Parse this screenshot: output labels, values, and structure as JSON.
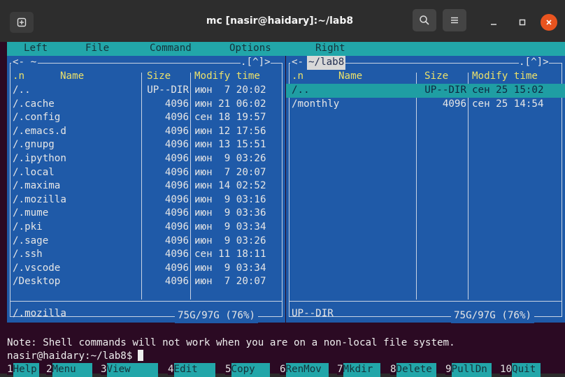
{
  "window": {
    "title": "mc [nasir@haidary]:~/lab8"
  },
  "menubar": {
    "items": [
      "Left",
      "File",
      "Command",
      "Options",
      "Right"
    ]
  },
  "left_panel": {
    "path": "~",
    "corner": ".[^]>",
    "columns": [
      ".n",
      "Name",
      "Size",
      "Modify time"
    ],
    "rows": [
      {
        "name": "/..",
        "size": "UP--DIR",
        "date": "июн  7 20:02"
      },
      {
        "name": "/.cache",
        "size": "4096",
        "date": "июн 21 06:02"
      },
      {
        "name": "/.config",
        "size": "4096",
        "date": "сен 18 19:57"
      },
      {
        "name": "/.emacs.d",
        "size": "4096",
        "date": "июн 12 17:56"
      },
      {
        "name": "/.gnupg",
        "size": "4096",
        "date": "июн 13 15:51"
      },
      {
        "name": "/.ipython",
        "size": "4096",
        "date": "июн  9 03:26"
      },
      {
        "name": "/.local",
        "size": "4096",
        "date": "июн  7 20:07"
      },
      {
        "name": "/.maxima",
        "size": "4096",
        "date": "июн 14 02:52"
      },
      {
        "name": "/.mozilla",
        "size": "4096",
        "date": "июн  9 03:16"
      },
      {
        "name": "/.mume",
        "size": "4096",
        "date": "июн  9 03:36"
      },
      {
        "name": "/.pki",
        "size": "4096",
        "date": "июн  9 03:34"
      },
      {
        "name": "/.sage",
        "size": "4096",
        "date": "июн  9 03:26"
      },
      {
        "name": "/.ssh",
        "size": "4096",
        "date": "сен 11 18:11"
      },
      {
        "name": "/.vscode",
        "size": "4096",
        "date": "июн  9 03:34"
      },
      {
        "name": "/Desktop",
        "size": "4096",
        "date": "июн  7 20:07"
      }
    ],
    "status": "/.mozilla",
    "usage": "75G/97G (76%)"
  },
  "right_panel": {
    "path": "~/lab8",
    "corner": ".[^]>",
    "columns": [
      ".n",
      "Name",
      "Size",
      "Modify time"
    ],
    "rows": [
      {
        "name": "/..",
        "size": "UP--DIR",
        "date": "сен 25 15:02"
      },
      {
        "name": "/monthly",
        "size": "4096",
        "date": "сен 25 14:54"
      }
    ],
    "status": "UP--DIR",
    "usage": "75G/97G (76%)"
  },
  "console": {
    "note": "Note: Shell commands will not work when you are on a non-local file system.",
    "prompt": "nasir@haidary:~/lab8$"
  },
  "fkeys": [
    {
      "num": "1",
      "label": "Help"
    },
    {
      "num": "2",
      "label": "Menu"
    },
    {
      "num": "3",
      "label": "View"
    },
    {
      "num": "4",
      "label": "Edit"
    },
    {
      "num": "5",
      "label": "Copy"
    },
    {
      "num": "6",
      "label": "RenMov"
    },
    {
      "num": "7",
      "label": "Mkdir"
    },
    {
      "num": "8",
      "label": "Delete"
    },
    {
      "num": "9",
      "label": "PullDn"
    },
    {
      "num": "10",
      "label": "Quit"
    }
  ],
  "colors": {
    "menubar": "#22a6a9",
    "panel": "#1f5aa8",
    "selection": "#1f9ea3",
    "terminal_bg": "#2b0a23",
    "header_text": "#ece16a",
    "close_button": "#e9541f"
  },
  "icons": {
    "new_tab": "new-tab-icon",
    "search": "search-icon",
    "menu": "hamburger-menu-icon",
    "minimize": "minimize-icon",
    "maximize": "maximize-icon",
    "close": "close-icon"
  }
}
